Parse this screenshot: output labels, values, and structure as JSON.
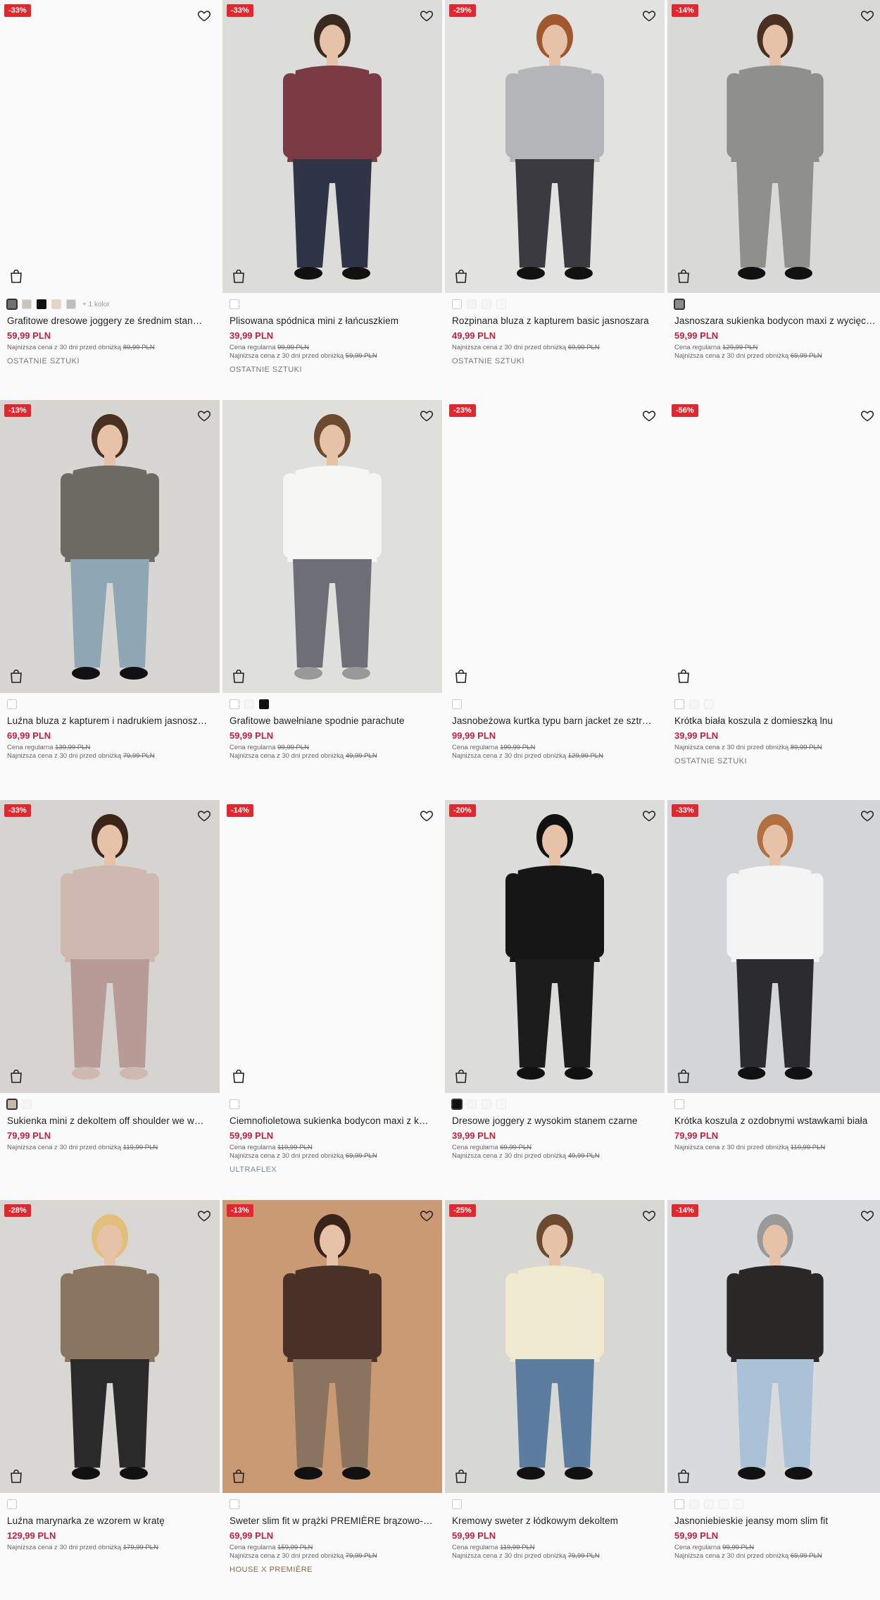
{
  "products": [
    {
      "name": "Grafitowe dresowe joggery ze średnim stan…",
      "price": "59,99 PLN",
      "discount": "-33%",
      "image": "empty",
      "swatches": [
        "#707070",
        "#c9c3b8",
        "#111111",
        "#ddd8c8",
        "#bdbdbd"
      ],
      "selected": 0,
      "more_colors": "+ 1 kolor",
      "regular": null,
      "lowest_label": "Najniższa cena z 30 dni przed obniżką",
      "lowest_price": "89,99 PLN",
      "tag": "OSTATNIE SZTUKI",
      "tag_style": "plain"
    },
    {
      "name": "Plisowana spódnica mini z łańcuszkiem",
      "price": "39,99 PLN",
      "discount": "-33%",
      "image": "skirt",
      "swatches": [
        "#ffffff"
      ],
      "selected": -1,
      "more_colors": "",
      "regular_label": "Cena regularna",
      "regular": "99,99 PLN",
      "lowest_label": "Najniższa cena z 30 dni przed obniżką",
      "lowest_price": "59,99 PLN",
      "tag": "OSTATNIE SZTUKI",
      "tag_style": "plain"
    },
    {
      "name": "Rozpinana bluza z kapturem basic jasnoszara",
      "price": "49,99 PLN",
      "discount": "-29%",
      "image": "hoodie-grey",
      "swatches": [
        "#ffffff",
        "#f3f3f3",
        "#f5f5f5",
        "#f7f7f7"
      ],
      "selected": -1,
      "more_colors": "",
      "regular": null,
      "lowest_label": "Najniższa cena z 30 dni przed obniżką",
      "lowest_price": "69,99 PLN",
      "tag": "OSTATNIE SZTUKI",
      "tag_style": "plain"
    },
    {
      "name": "Jasnoszara sukienka bodycon maxi z wycięci…",
      "price": "59,99 PLN",
      "discount": "-14%",
      "image": "dress-grey",
      "swatches": [
        "#8a8a88"
      ],
      "selected": 0,
      "more_colors": "",
      "regular_label": "Cena regularna",
      "regular": "129,99 PLN",
      "lowest_label": "Najniższa cena z 30 dni przed obniżką",
      "lowest_price": "69,99 PLN",
      "tag": "",
      "tag_style": "plain"
    },
    {
      "name": "Luźna bluza z kapturem i nadrukiem jasnosz…",
      "price": "69,99 PLN",
      "discount": "-13%",
      "image": "hoodie-brown",
      "swatches": [
        "#ffffff"
      ],
      "selected": -1,
      "more_colors": "",
      "regular_label": "Cena regularna",
      "regular": "139,99 PLN",
      "lowest_label": "Najniższa cena z 30 dni przed obniżką",
      "lowest_price": "79,99 PLN",
      "tag": "",
      "tag_style": "plain"
    },
    {
      "name": "Grafitowe bawełniane spodnie parachute",
      "price": "59,99 PLN",
      "discount": "",
      "image": "parachute",
      "swatches": [
        "#ffffff",
        "#f5f5f5",
        "#111111"
      ],
      "selected": -1,
      "more_colors": "",
      "regular_label": "Cena regularna",
      "regular": "99,99 PLN",
      "lowest_label": "Najniższa cena z 30 dni przed obniżką",
      "lowest_price": "49,99 PLN",
      "tag": "",
      "tag_style": "plain"
    },
    {
      "name": "Jasnobeżowa kurtka typu barn jacket ze sztr…",
      "price": "99,99 PLN",
      "discount": "-23%",
      "image": "empty",
      "swatches": [
        "#ffffff"
      ],
      "selected": -1,
      "more_colors": "",
      "regular_label": "Cena regularna",
      "regular": "199,99 PLN",
      "lowest_label": "Najniższa cena z 30 dni przed obniżką",
      "lowest_price": "129,99 PLN",
      "tag": "",
      "tag_style": "plain"
    },
    {
      "name": "Krótka biała koszula z domieszką lnu",
      "price": "39,99 PLN",
      "discount": "-56%",
      "image": "empty",
      "swatches": [
        "#ffffff",
        "#f5f5f5",
        "#f7f7f7"
      ],
      "selected": -1,
      "more_colors": "",
      "regular": null,
      "lowest_label": "Najniższa cena z 30 dni przed obniżką",
      "lowest_price": "89,99 PLN",
      "tag": "OSTATNIE SZTUKI",
      "tag_style": "plain"
    },
    {
      "name": "Sukienka mini z dekoltem off shoulder we w…",
      "price": "79,99 PLN",
      "discount": "-33%",
      "image": "tiedye",
      "swatches": [
        "#c7b8a8",
        "#f5f5f5"
      ],
      "selected": 0,
      "more_colors": "",
      "regular": null,
      "lowest_label": "Najniższa cena z 30 dni przed obniżką",
      "lowest_price": "119,99 PLN",
      "tag": "",
      "tag_style": "plain"
    },
    {
      "name": "Ciemnofioletowa sukienka bodycon maxi z k…",
      "price": "59,99 PLN",
      "discount": "-14%",
      "image": "empty",
      "swatches": [
        "#ffffff"
      ],
      "selected": -1,
      "more_colors": "",
      "regular_label": "Cena regularna",
      "regular": "119,99 PLN",
      "lowest_label": "Najniższa cena z 30 dni przed obniżką",
      "lowest_price": "69,99 PLN",
      "tag": "ULTRAFLEX",
      "tag_style": "ultraflex"
    },
    {
      "name": "Dresowe joggery z wysokim stanem czarne",
      "price": "39,99 PLN",
      "discount": "-20%",
      "image": "black-set",
      "swatches": [
        "#111111",
        "#f5f5f5",
        "#f6f6f6",
        "#f7f7f7"
      ],
      "selected": 0,
      "more_colors": "",
      "regular_label": "Cena regularna",
      "regular": "69,99 PLN",
      "lowest_label": "Najniższa cena z 30 dni przed obniżką",
      "lowest_price": "49,99 PLN",
      "tag": "",
      "tag_style": "plain"
    },
    {
      "name": "Krótka koszula z ozdobnymi wstawkami biała",
      "price": "79,99 PLN",
      "discount": "-33%",
      "image": "white-shirt",
      "swatches": [
        "#ffffff"
      ],
      "selected": -1,
      "more_colors": "",
      "regular": null,
      "lowest_label": "Najniższa cena z 30 dni przed obniżką",
      "lowest_price": "119,99 PLN",
      "tag": "",
      "tag_style": "plain"
    },
    {
      "name": "Luźna marynarka ze wzorem w kratę",
      "price": "129,99 PLN",
      "discount": "-28%",
      "image": "blazer",
      "swatches": [
        "#ffffff"
      ],
      "selected": -1,
      "more_colors": "",
      "regular": null,
      "lowest_label": "Najniższa cena z 30 dni przed obniżką",
      "lowest_price": "179,99 PLN",
      "tag": "",
      "tag_style": "plain"
    },
    {
      "name": "Sweter slim fit w prążki PREMIÈRE brązowo-…",
      "price": "69,99 PLN",
      "discount": "-13%",
      "image": "ribbed",
      "swatches": [
        "#ffffff"
      ],
      "selected": -1,
      "more_colors": "",
      "regular_label": "Cena regularna",
      "regular": "159,99 PLN",
      "lowest_label": "Najniższa cena z 30 dni przed obniżką",
      "lowest_price": "79,99 PLN",
      "tag": "HOUSE X PREMIÈRE",
      "tag_style": "premiere"
    },
    {
      "name": "Kremowy sweter z łódkowym dekoltem",
      "price": "59,99 PLN",
      "discount": "-25%",
      "image": "cream",
      "swatches": [
        "#ffffff"
      ],
      "selected": -1,
      "more_colors": "",
      "regular_label": "Cena regularna",
      "regular": "119,99 PLN",
      "lowest_label": "Najniższa cena z 30 dni przed obniżką",
      "lowest_price": "79,99 PLN",
      "tag": "",
      "tag_style": "plain"
    },
    {
      "name": "Jasnoniebieskie jeansy mom slim fit",
      "price": "59,99 PLN",
      "discount": "-14%",
      "image": "jeans",
      "swatches": [
        "#ffffff",
        "#f5f5f5",
        "#f6f6f6",
        "#f7f7f7",
        "#f8f8f8"
      ],
      "selected": -1,
      "more_colors": "",
      "regular_label": "Cena regularna",
      "regular": "99,99 PLN",
      "lowest_label": "Najniższa cena z 30 dni przed obniżką",
      "lowest_price": "69,99 PLN",
      "tag": "",
      "tag_style": "plain"
    }
  ],
  "colors": {
    "discount_badge": "#e3272f",
    "price": "#c8203b"
  }
}
